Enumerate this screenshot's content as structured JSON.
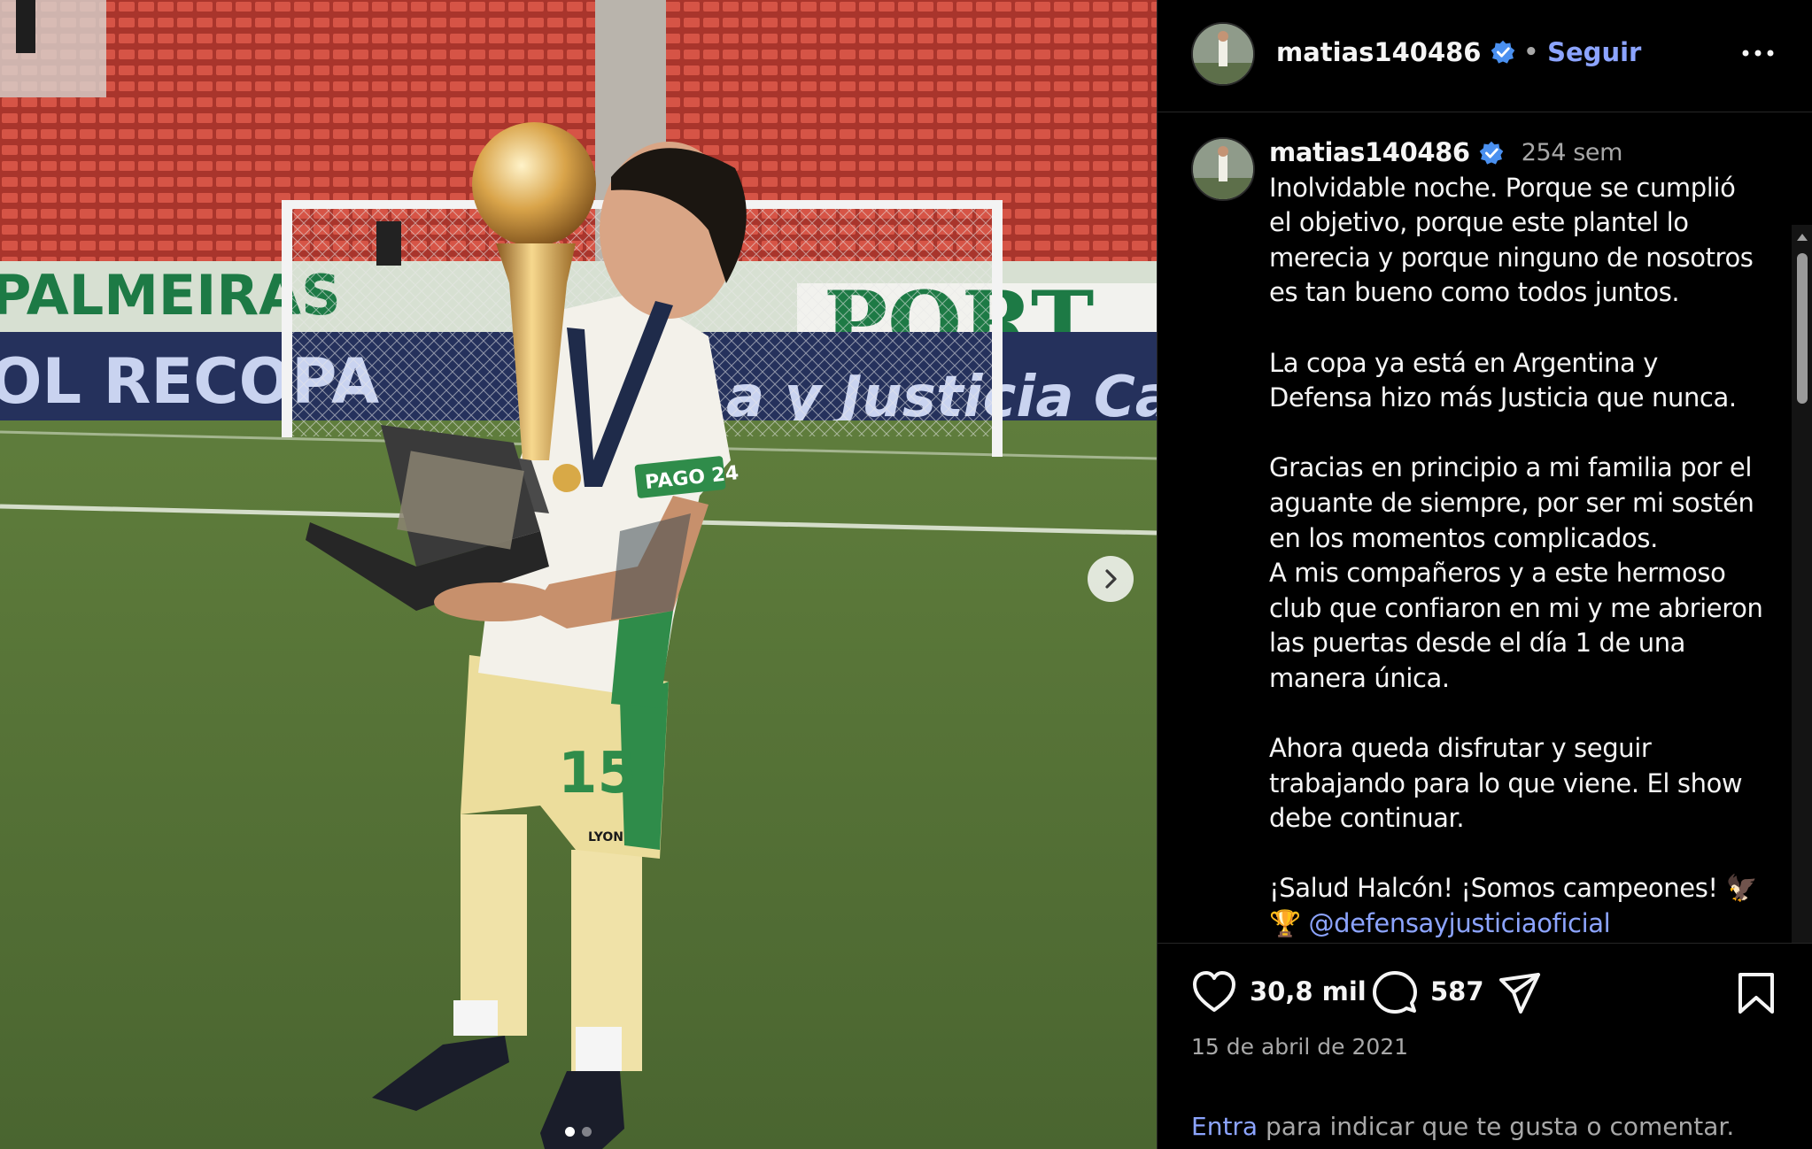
{
  "post": {
    "username": "matias140486",
    "separator": "•",
    "follow_label": "Seguir",
    "more_icon": "more-horizontal-icon",
    "caption": {
      "time_ago": "254 sem",
      "paragraph_1": "Inolvidable noche. Porque se cumplió el objetivo, porque este plantel lo merecia y porque ninguno de nosotros es tan bueno como todos juntos.",
      "paragraph_2": "La copa ya está en Argentina y Defensa hizo más Justicia que nunca.",
      "paragraph_3": "Gracias en principio a mi familia por el aguante de siempre, por ser mi sostén en los momentos complicados.",
      "paragraph_4": "A mis compañeros y a este hermoso club que confiaron en mi y me abrieron las puertas desde el día 1 de una manera única.",
      "paragraph_5": "Ahora queda disfrutar y seguir trabajando para lo que viene. El show debe continuar.",
      "paragraph_6": "¡Salud Halcón! ¡Somos campeones! 🦅",
      "trophy_emoji": "🏆",
      "mention": "@defensayjusticiaoficial"
    },
    "likes": "30,8 mil",
    "comments": "587",
    "date": "15 de abril de 2021",
    "login_link": "Entra",
    "login_text": " para indicar que te gusta o comentar."
  },
  "photo": {
    "banner_left_top": "PALMEIRAS",
    "banner_left_bottom": "OL RECOPA",
    "banner_right_top": "PORT",
    "banner_right_bottom": "a y Justicia Ca",
    "sponsor": "PAGO 24",
    "shirt_number": "15",
    "brand": "LYON"
  },
  "carousel": {
    "current": 1,
    "total": 2
  },
  "colors": {
    "link": "#8ca4ff",
    "verified": "#4a90f0",
    "muted": "#a8a8a8",
    "seats": "#c8463a",
    "grass": "#5c7a3a"
  }
}
